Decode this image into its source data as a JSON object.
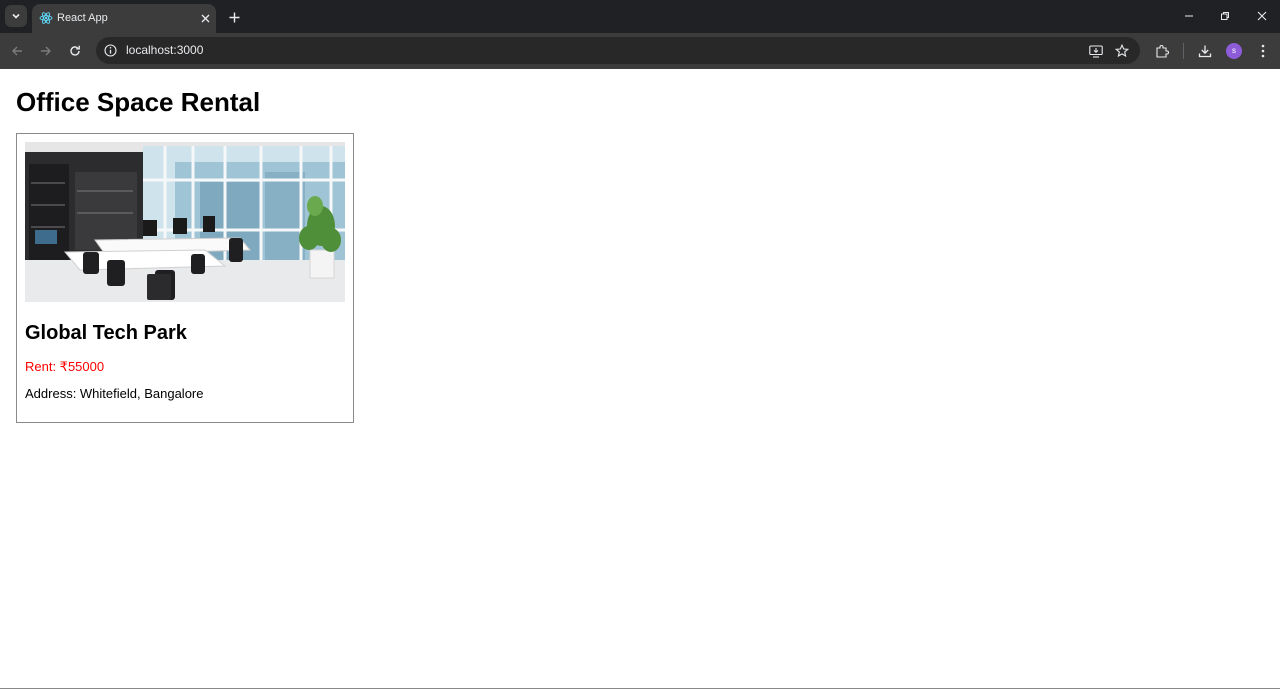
{
  "browser": {
    "tab": {
      "title": "React App"
    },
    "address_bar": {
      "url": "localhost:3000"
    },
    "profile": {
      "initial": "s"
    }
  },
  "page": {
    "heading": "Office Space Rental",
    "offices": [
      {
        "name": "Global Tech Park",
        "rent_label": "Rent: ₹55000",
        "address_label": "Address: Whitefield, Bangalore",
        "rent_color": "#ff0000"
      }
    ]
  }
}
